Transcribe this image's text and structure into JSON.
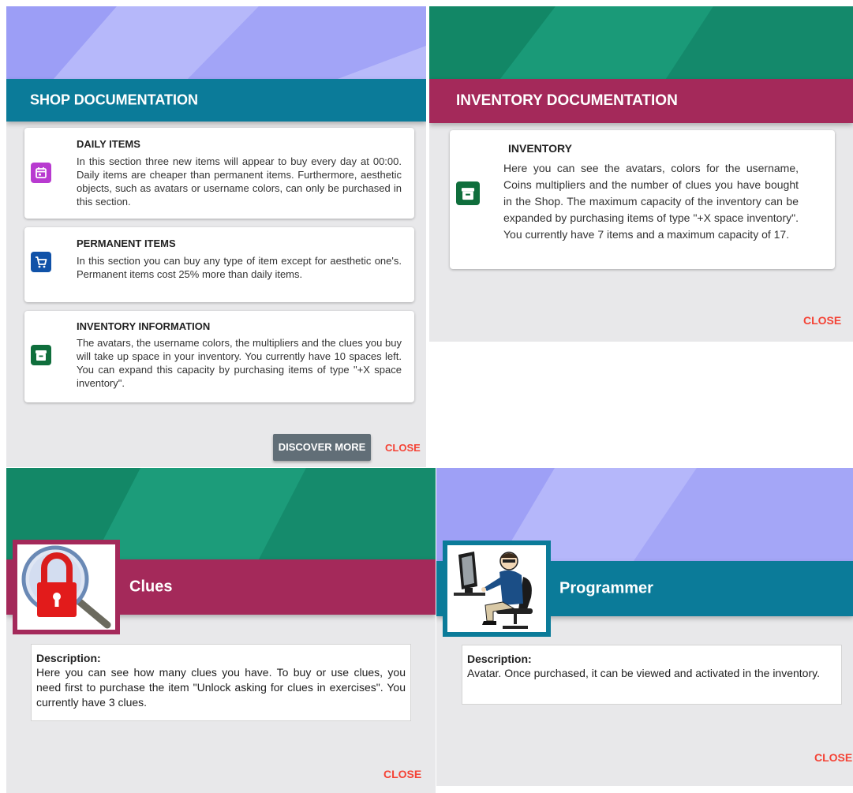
{
  "shop_doc": {
    "title": "SHOP DOCUMENTATION",
    "header_color": "#0b7b99",
    "cards": [
      {
        "title": "DAILY ITEMS",
        "icon": "calendar-icon",
        "icon_color": "#b83ad0",
        "body": "In this section three new items will appear to buy every day at 00:00. Daily items are cheaper than permanent items. Furthermore, aesthetic objects, such as avatars or username colors, can only be purchased in this section."
      },
      {
        "title": "PERMANENT ITEMS",
        "icon": "shopping-cart-icon",
        "icon_color": "#1052a8",
        "body": "In this section you can buy any type of item except for aesthetic one's. Permanent items cost 25% more than daily items."
      },
      {
        "title": "INVENTORY INFORMATION",
        "icon": "archive-box-icon",
        "icon_color": "#0f6e3c",
        "body": "The avatars, the username colors, the multipliers and the clues you buy will take up space in your inventory. You currently have 10 spaces left. You can expand this capacity by purchasing items of type \"+X space inventory\"."
      }
    ],
    "discover_label": "DISCOVER MORE",
    "close_label": "CLOSE"
  },
  "inventory_doc": {
    "title": "INVENTORY DOCUMENTATION",
    "header_color": "#a4295a",
    "card": {
      "title": "INVENTORY",
      "icon": "archive-box-icon",
      "icon_color": "#0f6e3c",
      "body": "Here you can see the avatars, colors for the username, Coins multipliers and the number of clues you have bought in the Shop. The maximum capacity of the inventory can be expanded by purchasing items of type \"+X space inventory\". You currently have 7 items and a maximum capacity of 17."
    },
    "close_label": "CLOSE"
  },
  "clues_item": {
    "title": "Clues",
    "header_color": "#a4295a",
    "frame_color": "#a4295a",
    "image": "padlock-magnifier-icon",
    "description_label": "Description:",
    "description": "Here you can see how many clues you have. To buy or use clues, you need first to purchase the item \"Unlock asking for clues in exercises\". You currently have 3 clues.",
    "close_label": "CLOSE"
  },
  "programmer_item": {
    "title": "Programmer",
    "header_color": "#0b7b99",
    "frame_color": "#0b7b99",
    "image": "programmer-avatar-icon",
    "description_label": "Description:",
    "description": "Avatar. Once purchased, it can be viewed and activated in the inventory.",
    "close_label": "CLOSE"
  },
  "colors": {
    "close": "#f44336",
    "hero_purple": "#a6a8f7",
    "hero_green": "#179474",
    "panel_bg": "#e8e8ea"
  }
}
